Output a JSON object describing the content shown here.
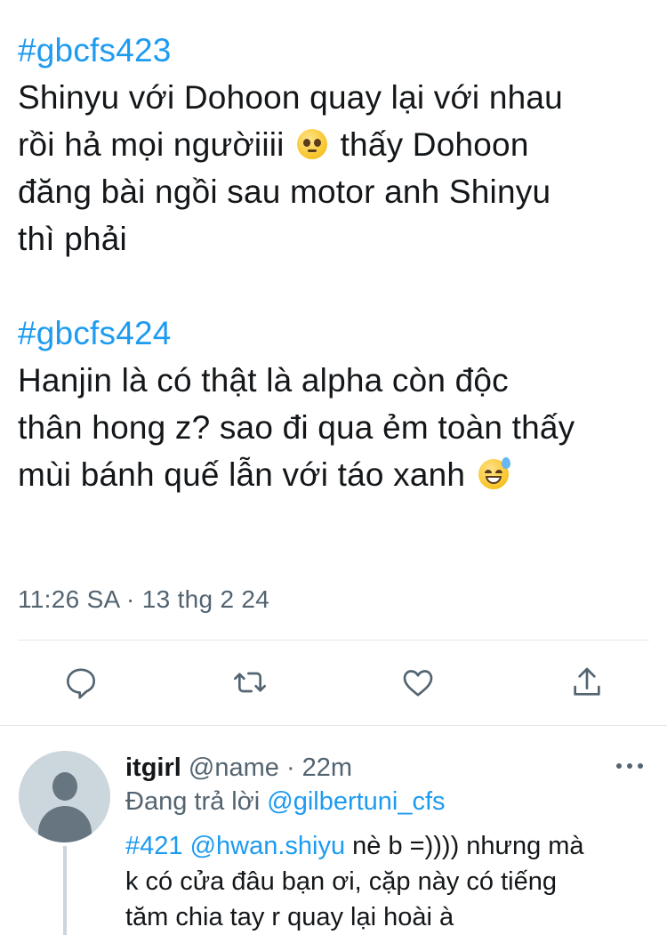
{
  "tweet": {
    "hashtag1": "#gbcfs423",
    "line1": "Shinyu với Dohoon quay lại với nhau",
    "line2a": "rồi hả mọi ngườiiii ",
    "line2b": " thấy Dohoon",
    "line3": "đăng bài ngồi sau motor anh Shinyu",
    "line4": "thì phải",
    "hashtag2": "#gbcfs424",
    "line5": "Hanjin là có thật là alpha còn độc",
    "line6": "thân hong z? sao đi qua ẻm toàn thấy",
    "line7": "mùi bánh quế lẫn với táo xanh ",
    "emoji1": "pleading-face-icon",
    "emoji2": "grinning-sweat-face-icon"
  },
  "timestamp": "11:26 SA · 13 thg 2 24",
  "actions": {
    "reply_icon": "reply-icon",
    "retweet_icon": "retweet-icon",
    "like_icon": "heart-icon",
    "share_icon": "share-icon"
  },
  "reply": {
    "name": "itgirl",
    "handle": " @name · 22m",
    "replying_prefix": "Đang trả lời ",
    "replying_handle": "@gilbertuni_cfs",
    "text_tag": "#421",
    "text_mention": "@hwan.shiyu",
    "text_rest1": " nè b =)))) nhưng mà",
    "text_line2": "k có cửa đâu bạn ơi, cặp này có tiếng",
    "text_line3": "tăm chia tay r quay lại hoài à"
  },
  "colors": {
    "link": "#1d9bf0",
    "secondary_text": "#536471",
    "divider": "#e1e8ed"
  }
}
